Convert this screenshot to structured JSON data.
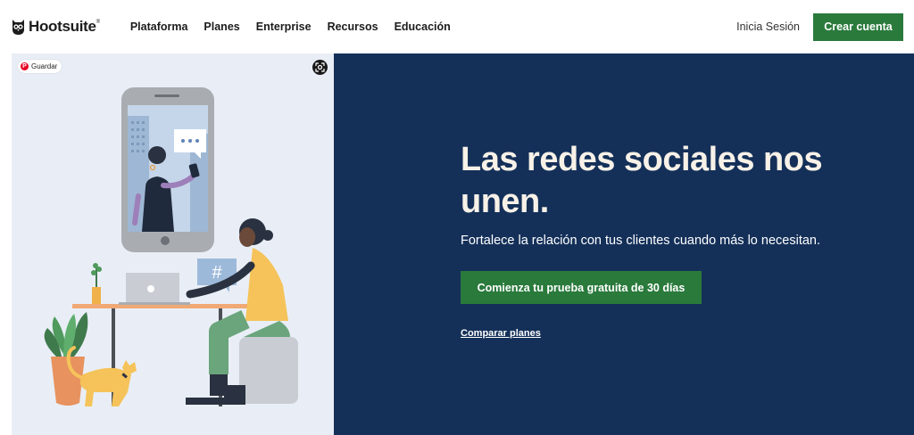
{
  "header": {
    "logo_text": "Hootsuite",
    "logo_mark": "®",
    "nav": [
      "Plataforma",
      "Planes",
      "Enterprise",
      "Recursos",
      "Educación"
    ],
    "login_label": "Inicia Sesión",
    "cta_label": "Crear cuenta"
  },
  "hero": {
    "save_label": "Guardar",
    "title": "Las redes sociales nos unen.",
    "subtitle": "Fortalece la relación con tus clientes cuando más lo necesitan.",
    "cta_label": "Comienza tu prueba gratuita de 30 días",
    "compare_label": "Comparar planes",
    "hashtag": "#"
  },
  "icons": {
    "logo": "owl-logo-icon",
    "pin": "pinterest-icon",
    "lens": "visual-search-icon",
    "chat": "speech-bubble-icon"
  },
  "colors": {
    "brand_green": "#2a7a3c",
    "hero_navy": "#143059",
    "illustration_bg": "#e9eef6",
    "title_cream": "#f7f1e8"
  }
}
